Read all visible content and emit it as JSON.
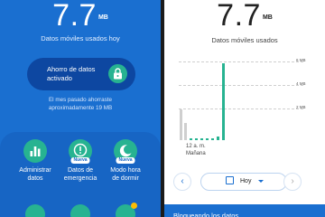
{
  "left": {
    "usage_value": "7.7",
    "usage_unit": "MB",
    "usage_caption": "Datos móviles usados hoy",
    "data_saver": {
      "line1": "Ahorro de datos",
      "line2": "activado"
    },
    "saved_line1": "El mes pasado ahorraste",
    "saved_line2": "aproximadamente 19 MB",
    "tiles": [
      {
        "line1": "Administrar",
        "line2": "datos",
        "icon": "bar-chart-icon"
      },
      {
        "line1": "Datos de",
        "line2": "emergencia",
        "icon": "emergency-data-icon",
        "badge": "Nueva"
      },
      {
        "line1": "Modo hora",
        "line2": "de dormir",
        "icon": "moon-icon",
        "badge": "Nueva"
      }
    ]
  },
  "right": {
    "usage_value": "7.7",
    "usage_unit": "MB",
    "usage_caption": "Datos móviles usados",
    "grid_labels": [
      "6 MB",
      "4 MB",
      "2 MB"
    ],
    "time_label_line1": "12 a. m.",
    "time_label_line2": "Mañana",
    "date_picker_value": "Hoy",
    "footer_text": "Bloqueando los datos"
  },
  "colors": {
    "brand_blue": "#1a6fd0",
    "accent_green": "#27b391",
    "badge_yellow": "#fbbc05"
  }
}
